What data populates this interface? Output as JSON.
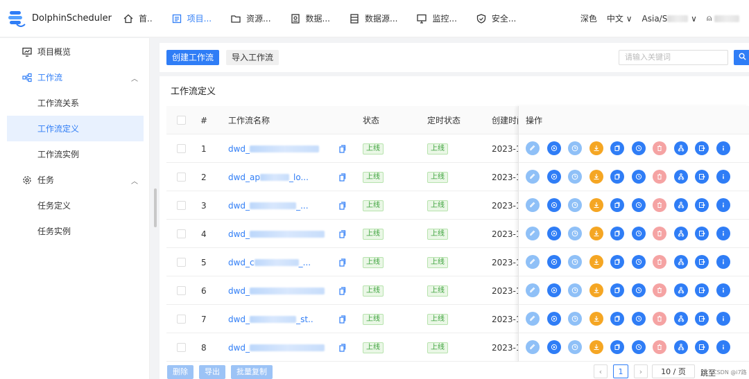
{
  "brand": {
    "name": "DolphinScheduler"
  },
  "nav": {
    "items": [
      {
        "label": "首..",
        "icon": "home-icon"
      },
      {
        "label": "项目...",
        "icon": "project-icon",
        "active": true
      },
      {
        "label": "资源...",
        "icon": "folder-icon"
      },
      {
        "label": "数据...",
        "icon": "data-quality-icon"
      },
      {
        "label": "数据源...",
        "icon": "datasource-icon"
      },
      {
        "label": "监控...",
        "icon": "monitor-icon"
      },
      {
        "label": "安全...",
        "icon": "shield-icon"
      }
    ],
    "theme": "深色",
    "language": "中文",
    "timezone": "Asia/S"
  },
  "sidebar": {
    "items": [
      {
        "label": "项目概览",
        "icon": "overview-icon",
        "level": 1
      },
      {
        "label": "工作流",
        "icon": "workflow-icon",
        "level": 1,
        "expanded": true
      },
      {
        "label": "工作流关系",
        "level": 2
      },
      {
        "label": "工作流定义",
        "level": 2,
        "selected": true
      },
      {
        "label": "工作流实例",
        "level": 2
      },
      {
        "label": "任务",
        "icon": "gear-icon",
        "level": 1,
        "expanded": true
      },
      {
        "label": "任务定义",
        "level": 2
      },
      {
        "label": "任务实例",
        "level": 2
      }
    ]
  },
  "toolbar": {
    "create_label": "创建工作流",
    "import_label": "导入工作流",
    "search_placeholder": "请输入关键词"
  },
  "card": {
    "title": "工作流定义"
  },
  "table": {
    "columns": [
      "#",
      "工作流名称",
      "状态",
      "定时状态",
      "创建时间",
      "操作"
    ],
    "rows": [
      {
        "index": "1",
        "name": "dwd_",
        "status": "上线",
        "schedule": "上线",
        "created": "2023-1("
      },
      {
        "index": "2",
        "name": "dwd_ap",
        "name_tail": "_lo...",
        "status": "上线",
        "schedule": "上线",
        "created": "2023-1:"
      },
      {
        "index": "3",
        "name": "dwd_",
        "name_tail": "_...",
        "status": "上线",
        "schedule": "上线",
        "created": "2023-1("
      },
      {
        "index": "4",
        "name": "dwd_",
        "status": "上线",
        "schedule": "上线",
        "created": "2023-1("
      },
      {
        "index": "5",
        "name": "dwd_c",
        "name_tail": "_...",
        "status": "上线",
        "schedule": "上线",
        "created": "2023-1("
      },
      {
        "index": "6",
        "name": "dwd_",
        "status": "上线",
        "schedule": "上线",
        "created": "2023-1("
      },
      {
        "index": "7",
        "name": "dwd_",
        "name_tail": "_st..",
        "status": "上线",
        "schedule": "上线",
        "created": "2023-1("
      },
      {
        "index": "8",
        "name": "dwd_",
        "status": "上线",
        "schedule": "上线",
        "created": "2023-1("
      }
    ],
    "operations": [
      {
        "name": "edit-icon",
        "color": "#8fc0f7"
      },
      {
        "name": "run-icon",
        "color": "#2f7df6"
      },
      {
        "name": "timing-icon",
        "color": "#8fc0f7"
      },
      {
        "name": "offline-icon",
        "color": "#f5a623"
      },
      {
        "name": "copy-icon",
        "color": "#2f7df6"
      },
      {
        "name": "cron-manage-icon",
        "color": "#2f7df6"
      },
      {
        "name": "delete-icon",
        "color": "#f5a3a3"
      },
      {
        "name": "tree-view-icon",
        "color": "#2f7df6"
      },
      {
        "name": "export-icon",
        "color": "#2f7df6"
      },
      {
        "name": "info-icon",
        "color": "#2f7df6"
      }
    ]
  },
  "bottom": {
    "delete_label": "删除",
    "export_label": "导出",
    "batch_copy_label": "批量复制",
    "current_page": "1",
    "page_size": "10 / 页",
    "jump_label": "跳至"
  },
  "watermark": "CSDN @i7路"
}
